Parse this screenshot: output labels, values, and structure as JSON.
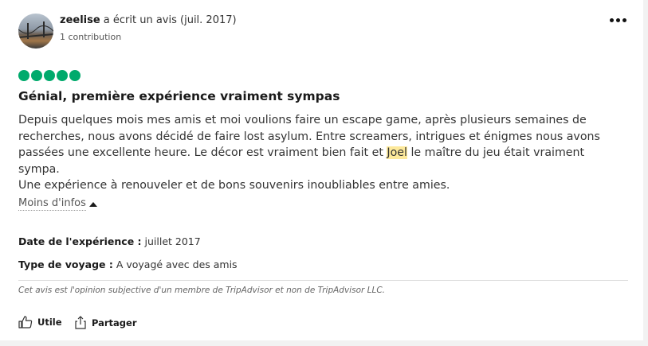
{
  "review": {
    "author": "zeelise",
    "action": " a écrit un avis (juil. 2017)",
    "contributions": "1 contribution",
    "rating": 5,
    "title": "Génial, première expérience vraiment sympas",
    "body_part1": "Depuis quelques mois mes amis et moi voulions faire un escape game, après plusieurs semaines de recherches, nous avons décidé de faire lost asylum. Entre screamers, intrigues et énigmes nous avons passées une excellente heure. Le décor est vraiment bien fait et ",
    "body_highlight": "Joel",
    "body_part2": " le maître du jeu était vraiment sympa.",
    "body_line2": "Une expérience à renouveler et de bons souvenirs inoubliables entre amies.",
    "less_label": "Moins d'infos",
    "experience_date_label": "Date de l'expérience :",
    "experience_date": " juillet 2017",
    "trip_type_label": "Type de voyage :",
    "trip_type": " A voyagé avec des amis",
    "disclaimer": "Cet avis est l'opinion subjective d'un membre de TripAdvisor et non de TripAdvisor LLC."
  },
  "actions": {
    "helpful_label": "Utile",
    "share_label": "Partager"
  },
  "colors": {
    "bubble": "#00aa6c",
    "highlight": "#fde99b"
  },
  "icons": [
    "more-options-icon",
    "thumbs-up-icon",
    "share-icon"
  ]
}
